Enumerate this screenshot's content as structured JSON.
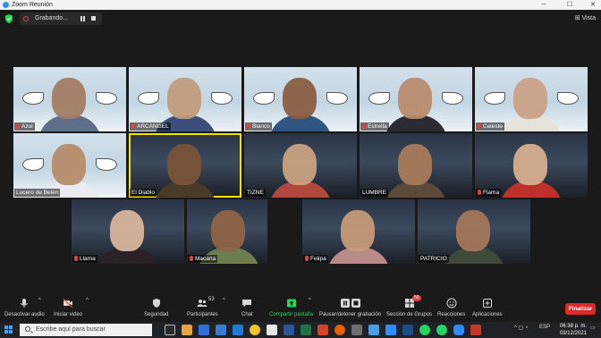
{
  "window": {
    "title": "Zoom Reunión",
    "controls": {
      "minimize": "─",
      "maximize": "☐",
      "close": "✕"
    }
  },
  "meeting_bar": {
    "recording_label": "Grabando...",
    "view_label": "Vista"
  },
  "participants": [
    {
      "name": "Azul",
      "muted": true
    },
    {
      "name": "ARCANGEL",
      "muted": true
    },
    {
      "name": "Blanco",
      "muted": true
    },
    {
      "name": "Estrella",
      "muted": true
    },
    {
      "name": "Celeste",
      "muted": true
    },
    {
      "name": "Lucero de Belén",
      "muted": false
    },
    {
      "name": "El Diablo",
      "muted": false,
      "speaking": true
    },
    {
      "name": "TIZNE",
      "muted": false
    },
    {
      "name": "LUMBRE",
      "muted": false
    },
    {
      "name": "Flama",
      "muted": true
    },
    {
      "name": "Llama",
      "muted": true
    },
    {
      "name": "Macaria",
      "muted": true
    },
    {
      "name": "Felipa",
      "muted": true
    },
    {
      "name": "PATRICIO",
      "muted": false
    }
  ],
  "toolbar": {
    "mute_audio": "Desactivar audio",
    "start_video": "Iniciar video",
    "security": "Seguridad",
    "participants": "Participantes",
    "participants_count": "53",
    "chat": "Chat",
    "share_screen": "Compartir pantalla",
    "pause_recording": "Pausar/detener grabación",
    "breakout_rooms": "Sección de Grupos",
    "breakout_badge": "50",
    "reactions": "Reacciones",
    "apps": "Aplicaciones",
    "end": "Finalizar"
  },
  "taskbar": {
    "search_placeholder": "Escribe aquí para buscar",
    "language": "ESP",
    "time": "06:38 p. m.",
    "date": "03/12/2021"
  },
  "colors": {
    "accent_green": "#23d959",
    "end_red": "#e02828",
    "active_speaker": "#f5e400",
    "mic_muted": "#e2423e"
  }
}
